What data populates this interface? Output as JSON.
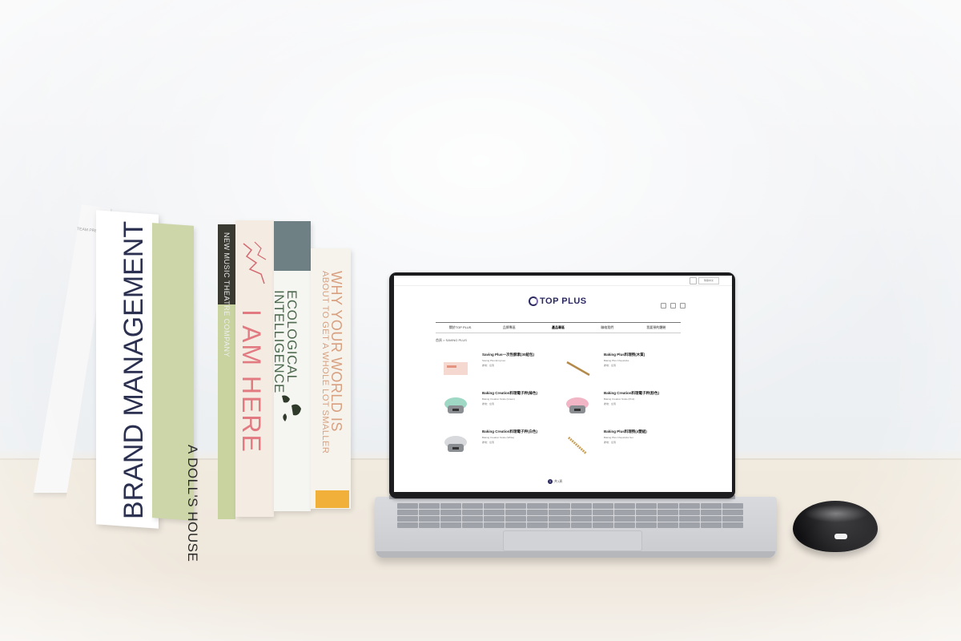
{
  "books": {
    "brand_management": {
      "title": "BRAND MANAGEMENT",
      "cover_small": "BRAND MANAGEMENT",
      "cover_top": "TEAM PRESALE"
    },
    "dolls_house": {
      "title": "A DOLL'S HOUSE"
    },
    "theatre": {
      "title": "NEW MUSIC THEATRE COMPANY"
    },
    "i_am_here": {
      "title": "I AM HERE"
    },
    "ecological": {
      "title_line1": "ECOLOGICAL",
      "title_line2": "INTELLIGENCE"
    },
    "world": {
      "title_line1": "WHY YOUR WORLD IS",
      "title_line2": "ABOUT TO GET A WHOLE LOT SMALLER"
    }
  },
  "website": {
    "brand": "TOP PLUS",
    "lang_button": "繁體中文",
    "nav": [
      "關於TOP PLUS",
      "品牌專區",
      "產品專區",
      "聯絡我們",
      "我要預約體驗"
    ],
    "active_nav_index": 2,
    "breadcrumb": "首頁 > SAVING PLUS",
    "products": [
      {
        "name": "Saving Plus一次性酵素(30組包)",
        "desc": "Saving Plus Enzymes"
      },
      {
        "name": "Baking Plus料理筷(木質)",
        "desc": "Baking Plus Chopsticks"
      },
      {
        "name": "Baking Creation料理電子秤(綠色)",
        "desc": "Baking Creation Scale (Green)"
      },
      {
        "name": "Baking Creation料理電子秤(粉色)",
        "desc": "Baking Creation Scale (Pink)"
      },
      {
        "name": "Baking Creation料理電子秤(白色)",
        "desc": "Baking Creation Scale (White)"
      },
      {
        "name": "Baking Plus料理筷(4雙組)",
        "desc": "Baking Plus Chopsticks Set"
      }
    ],
    "product_meta_label": "產地：台灣",
    "pager_current": "1",
    "pager_text": "共1頁"
  },
  "colors": {
    "brand": "#2b2960",
    "book_pink": "#e27a82",
    "book_green": "#4e6a4e",
    "book_orange": "#f1b03a",
    "laptop_bezel": "#1d1d1f",
    "mouse": "#101012"
  }
}
